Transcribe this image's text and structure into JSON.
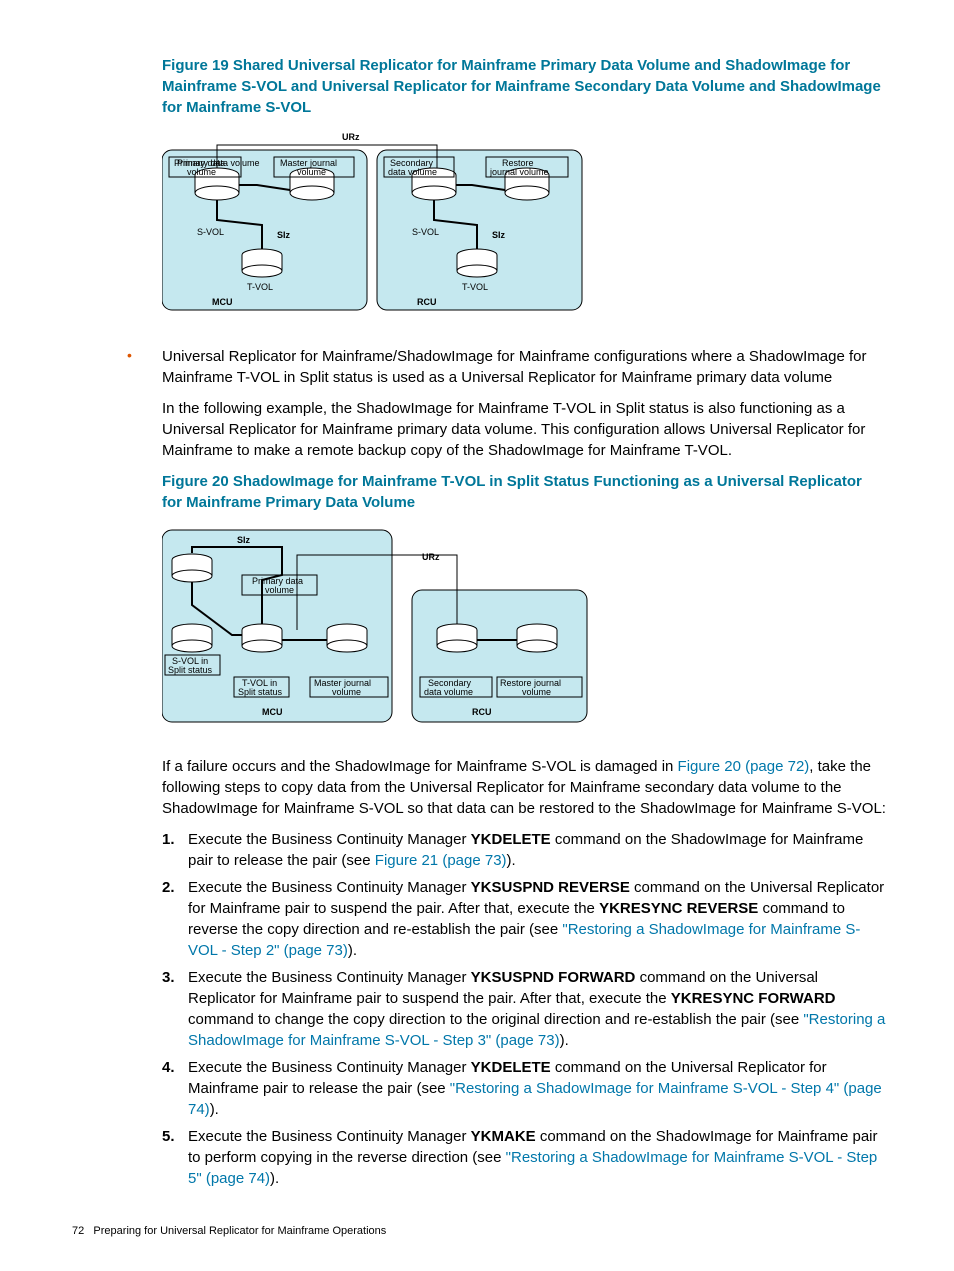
{
  "figure19": {
    "title": "Figure 19 Shared Universal Replicator for Mainframe Primary Data Volume and ShadowImage for Mainframe S-VOL and Universal Replicator for Mainframe Secondary Data Volume and ShadowImage for Mainframe S-VOL",
    "labels": {
      "urz": "URz",
      "primary_data_volume": "Primary data volume",
      "master_journal_volume": "Master journal volume",
      "secondary_data_volume": "Secondary data volume",
      "restore_journal_volume": "Restore journal volume",
      "svol": "S-VOL",
      "siz": "SIz",
      "tvol": "T-VOL",
      "mcu": "MCU",
      "rcu": "RCU"
    }
  },
  "bullet": {
    "para1": "Universal Replicator for Mainframe/ShadowImage for Mainframe configurations where a ShadowImage for Mainframe T-VOL in Split status is used as a Universal Replicator for Mainframe primary data volume",
    "para2": "In the following example, the ShadowImage for Mainframe T-VOL in Split status is also functioning as a Universal Replicator for Mainframe primary data volume. This configuration allows Universal Replicator for Mainframe to make a remote backup copy of the ShadowImage for Mainframe T-VOL."
  },
  "figure20": {
    "title": "Figure 20 ShadowImage for Mainframe T-VOL in Split Status Functioning as a Universal Replicator for Mainframe Primary Data Volume",
    "labels": {
      "siz": "SIz",
      "urz": "URz",
      "primary_data_volume": "Primary data volume",
      "svol_split": "S-VOL in Split status",
      "tvol_split": "T-VOL in Split status",
      "master_journal_volume": "Master journal volume",
      "secondary_data_volume": "Secondary data volume",
      "restore_journal_volume": "Restore journal volume",
      "mcu": "MCU",
      "rcu": "RCU"
    }
  },
  "after_fig20": {
    "pre": "If a failure occurs and the ShadowImage for Mainframe S-VOL is damaged in ",
    "link": "Figure 20 (page 72)",
    "post": ", take the following steps to copy data from the Universal Replicator for Mainframe secondary data volume to the ShadowImage for Mainframe S-VOL so that data can be restored to the ShadowImage for Mainframe S-VOL:"
  },
  "steps": [
    {
      "num": "1.",
      "t1": "Execute the Business Continuity Manager ",
      "b1": "YKDELETE",
      "t2": " command on the ShadowImage for Mainframe pair to release the pair (see ",
      "link": "Figure 21 (page 73)",
      "t3": ")."
    },
    {
      "num": "2.",
      "t1": "Execute the Business Continuity Manager ",
      "b1": "YKSUSPND REVERSE",
      "t2": " command on the Universal Replicator for Mainframe pair to suspend the pair. After that, execute the ",
      "b2": "YKRESYNC REVERSE",
      "t3": " command to reverse the copy direction and re-establish the pair (see ",
      "qlink": "\"Restoring a ShadowImage for Mainframe S-VOL - Step 2\" (page 73)",
      "t4": ")."
    },
    {
      "num": "3.",
      "t1": "Execute the Business Continuity Manager ",
      "b1": "YKSUSPND FORWARD",
      "t2": " command on the Universal Replicator for Mainframe pair to suspend the pair. After that, execute the ",
      "b2": "YKRESYNC FORWARD",
      "t3": " command to change the copy direction to the original direction and re-establish the pair (see ",
      "qlink": "\"Restoring a ShadowImage for Mainframe S-VOL - Step 3\" (page 73)",
      "t4": ")."
    },
    {
      "num": "4.",
      "t1": "Execute the Business Continuity Manager ",
      "b1": "YKDELETE",
      "t2": " command on the Universal Replicator for Mainframe pair to release the pair (see ",
      "qlink": "\"Restoring a ShadowImage for Mainframe S-VOL - Step 4\" (page 74)",
      "t3": ")."
    },
    {
      "num": "5.",
      "t1": "Execute the Business Continuity Manager ",
      "b1": "YKMAKE",
      "t2": " command on the ShadowImage for Mainframe pair to perform copying in the reverse direction (see ",
      "qlink": "\"Restoring a ShadowImage for Mainframe S-VOL - Step 5\" (page 74)",
      "t3": ")."
    }
  ],
  "footer": {
    "page": "72",
    "chapter": "Preparing for Universal Replicator for Mainframe Operations"
  }
}
